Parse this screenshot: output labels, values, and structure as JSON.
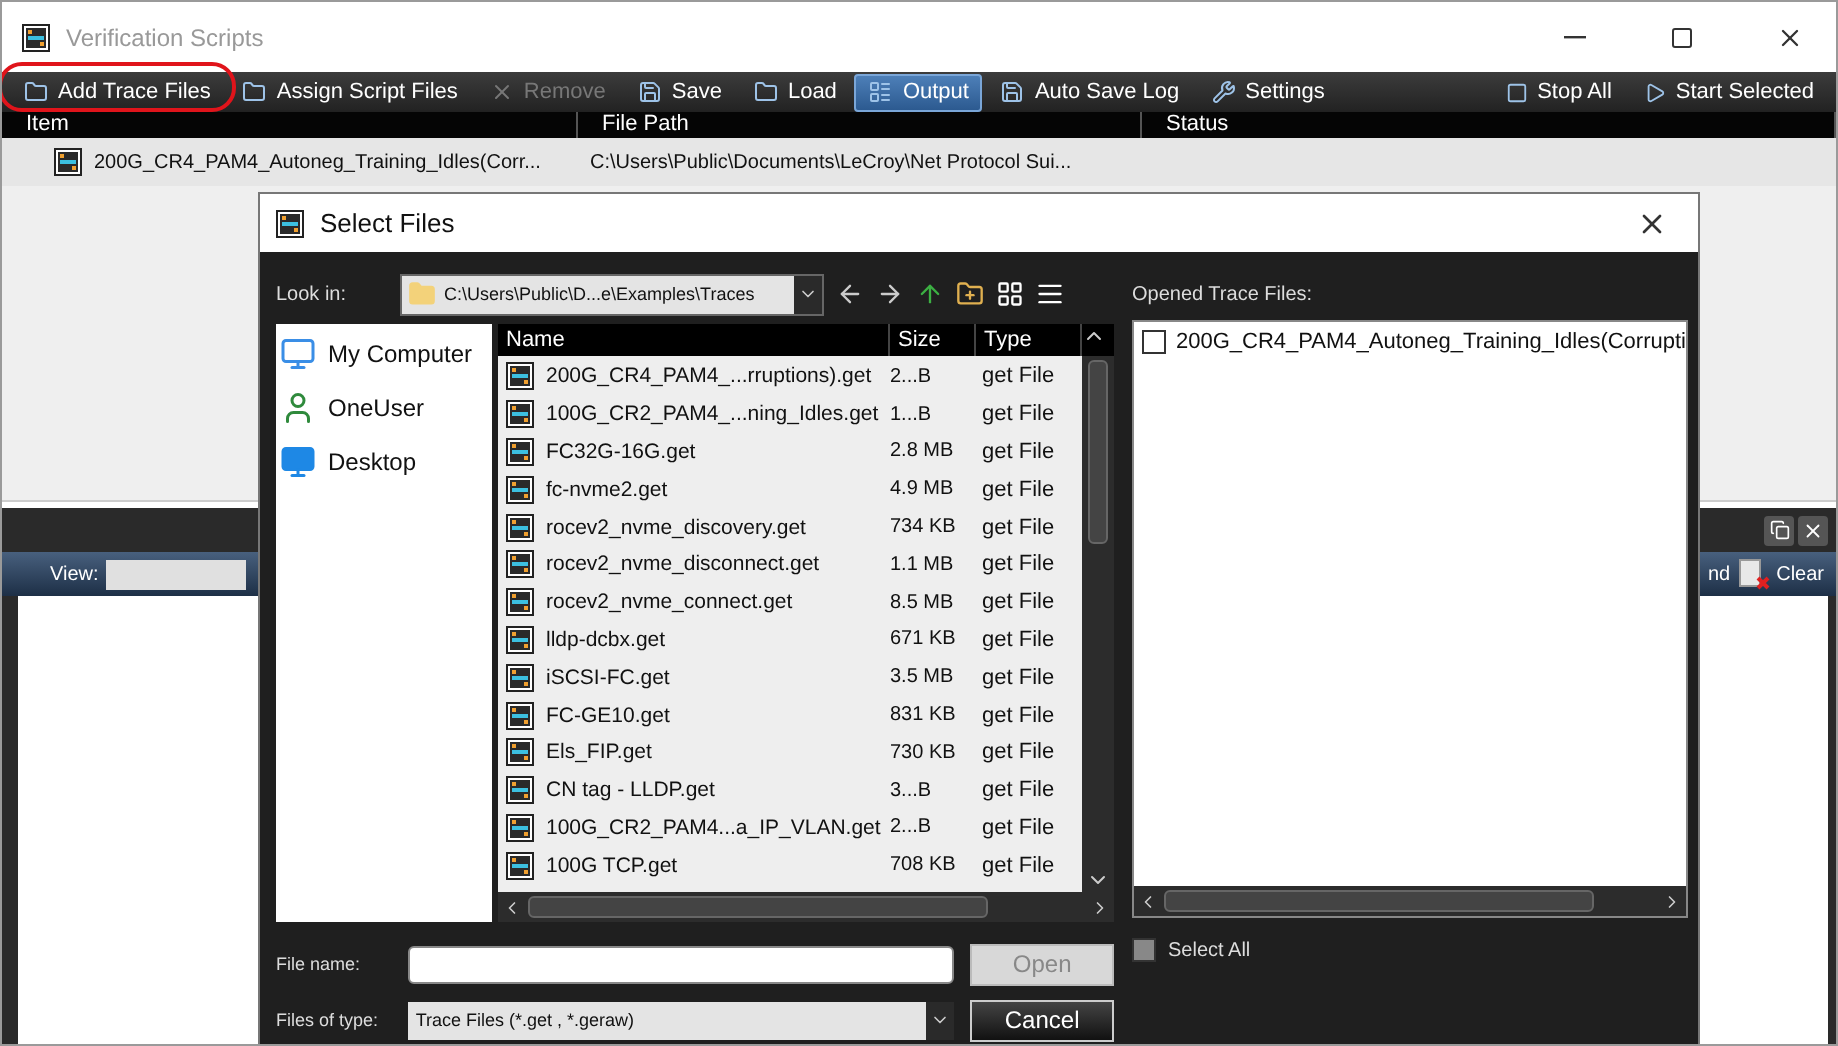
{
  "window": {
    "title": "Verification Scripts"
  },
  "toolbar": [
    {
      "label": "Add Trace Files",
      "disabled": false,
      "selected": false,
      "highlighted": true
    },
    {
      "label": "Assign Script Files",
      "disabled": false,
      "selected": false,
      "highlighted": false
    },
    {
      "label": "Remove",
      "disabled": true,
      "selected": false,
      "highlighted": false
    },
    {
      "label": "Save",
      "disabled": false,
      "selected": false,
      "highlighted": false
    },
    {
      "label": "Load",
      "disabled": false,
      "selected": false,
      "highlighted": false
    },
    {
      "label": "Output",
      "disabled": false,
      "selected": true,
      "highlighted": false
    },
    {
      "label": "Auto Save Log",
      "disabled": false,
      "selected": false,
      "highlighted": false
    },
    {
      "label": "Settings",
      "disabled": false,
      "selected": false,
      "highlighted": false
    }
  ],
  "toolbar_right": [
    "Stop All",
    "Start Selected"
  ],
  "table": {
    "columns": [
      "Item",
      "File Path",
      "Status"
    ],
    "rows": [
      {
        "item": "200G_CR4_PAM4_Autoneg_Training_Idles(Corr...",
        "file_path": "C:\\Users\\Public\\Documents\\LeCroy\\Net Protocol Sui..."
      }
    ]
  },
  "output_panel": {
    "view_label": "View:",
    "buttons": [
      "nd",
      "Clear"
    ]
  },
  "dialog": {
    "title": "Select Files",
    "look_in_label": "Look in:",
    "look_in_path": "C:\\Users\\Public\\D...e\\Examples\\Traces",
    "places": [
      "My Computer",
      "OneUser",
      "Desktop"
    ],
    "columns": [
      "Name",
      "Size",
      "Type"
    ],
    "files": [
      {
        "name": "200G_CR4_PAM4_...rruptions).get",
        "size": "2...B",
        "type": "get File"
      },
      {
        "name": "100G_CR2_PAM4_...ning_Idles.get",
        "size": "1...B",
        "type": "get File"
      },
      {
        "name": "FC32G-16G.get",
        "size": "2.8 MB",
        "type": "get File"
      },
      {
        "name": "fc-nvme2.get",
        "size": "4.9 MB",
        "type": "get File"
      },
      {
        "name": "rocev2_nvme_discovery.get",
        "size": "734 KB",
        "type": "get File"
      },
      {
        "name": "rocev2_nvme_disconnect.get",
        "size": "1.1 MB",
        "type": "get File"
      },
      {
        "name": "rocev2_nvme_connect.get",
        "size": "8.5 MB",
        "type": "get File"
      },
      {
        "name": "lldp-dcbx.get",
        "size": "671 KB",
        "type": "get File"
      },
      {
        "name": "iSCSI-FC.get",
        "size": "3.5 MB",
        "type": "get File"
      },
      {
        "name": "FC-GE10.get",
        "size": "831 KB",
        "type": "get File"
      },
      {
        "name": "Els_FIP.get",
        "size": "730 KB",
        "type": "get File"
      },
      {
        "name": "CN tag - LLDP.get",
        "size": "3...B",
        "type": "get File"
      },
      {
        "name": "100G_CR2_PAM4...a_IP_VLAN.get",
        "size": "2...B",
        "type": "get File"
      },
      {
        "name": "100G TCP.get",
        "size": "708 KB",
        "type": "get File"
      }
    ],
    "opened_label": "Opened Trace Files:",
    "opened_files": [
      {
        "name": "200G_CR4_PAM4_Autoneg_Training_Idles(Corrupti",
        "checked": false
      }
    ],
    "select_all": {
      "label": "Select All",
      "checked": false
    },
    "file_name_label": "File name:",
    "file_type_label": "Files of type:",
    "file_type_value": "Trace Files (*.get , *.geraw)",
    "open_button": {
      "label": "Open",
      "disabled": true
    },
    "cancel_button": {
      "label": "Cancel"
    }
  }
}
